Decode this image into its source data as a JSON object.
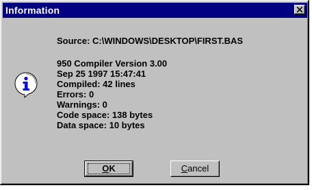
{
  "window": {
    "title": "Information"
  },
  "icons": {
    "dialog": "information-balloon-icon",
    "close": "close-x-icon"
  },
  "message": {
    "source": "Source: C:\\WINDOWS\\DESKTOP\\FIRST.BAS",
    "details": [
      "950 Compiler Version 3.00",
      "Sep 25 1997 15:47:41",
      "Compiled: 42 lines",
      "Errors: 0",
      "Warnings: 0",
      "Code space: 138 bytes",
      "Data space: 10 bytes"
    ]
  },
  "buttons": {
    "ok": {
      "mnemonic": "O",
      "rest": "K"
    },
    "cancel": {
      "mnemonic": "C",
      "rest": "ancel"
    }
  },
  "colors": {
    "titlebar": "#000080",
    "face": "#c0c0c0",
    "icon_accent": "#0000ff"
  }
}
